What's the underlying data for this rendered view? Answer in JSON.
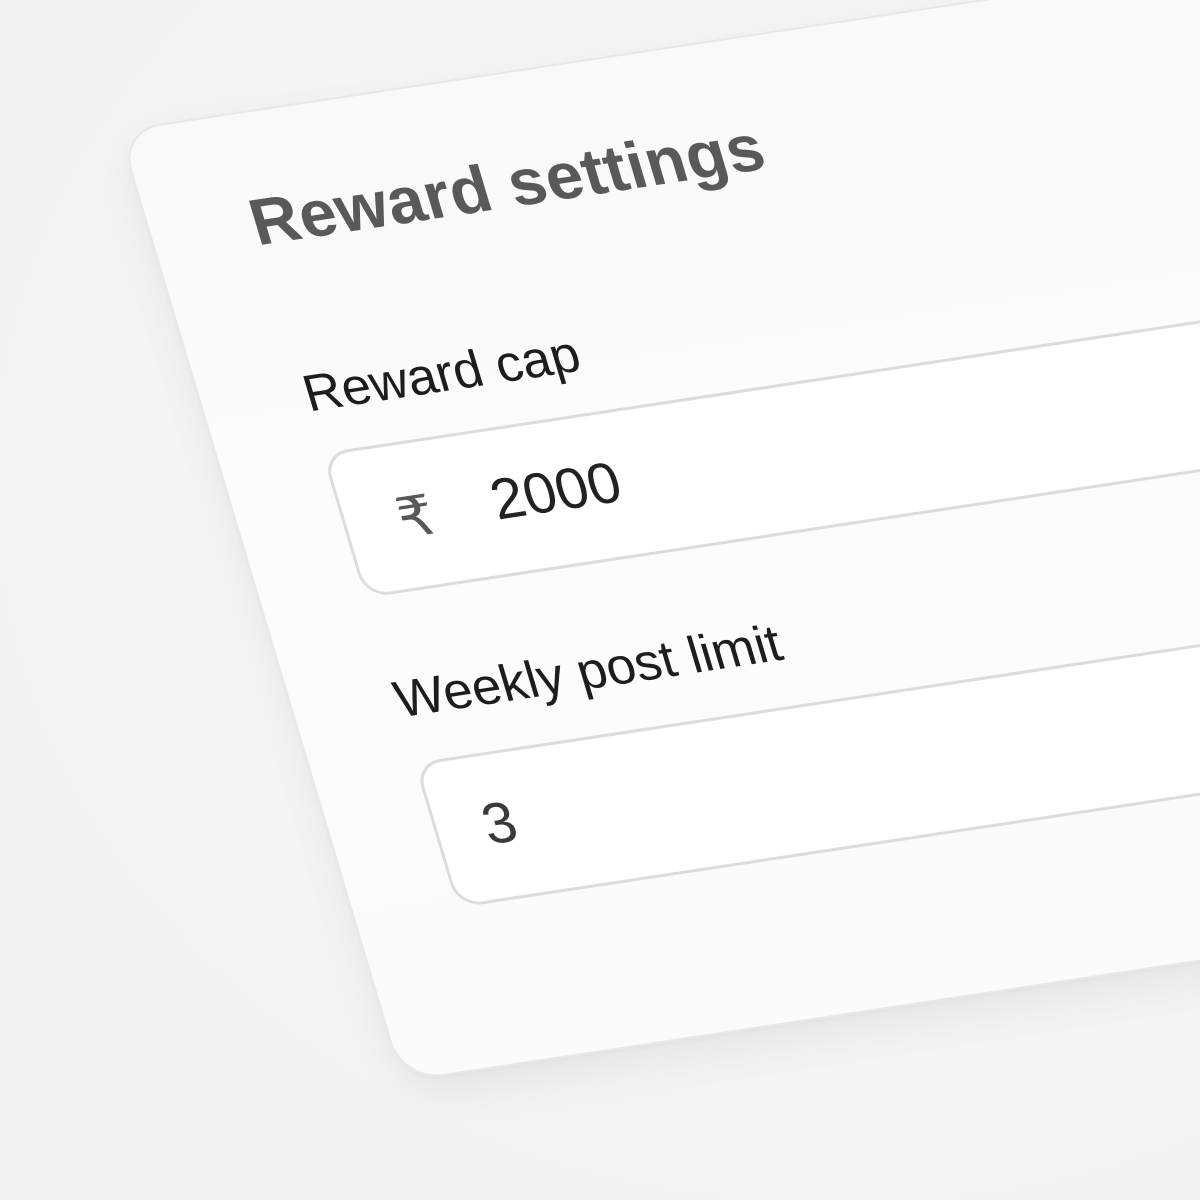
{
  "card": {
    "title": "Reward settings"
  },
  "fields": {
    "reward_cap": {
      "label": "Reward cap",
      "currency_symbol": "₹",
      "value": "2000"
    },
    "weekly_post_limit": {
      "label": "Weekly post limit",
      "value": "3"
    }
  },
  "colors": {
    "background": "#f6f5f3",
    "card": "#fbfbfa",
    "title": "#595959",
    "label": "#1d1d1d",
    "input_border": "#dcdcdb"
  }
}
